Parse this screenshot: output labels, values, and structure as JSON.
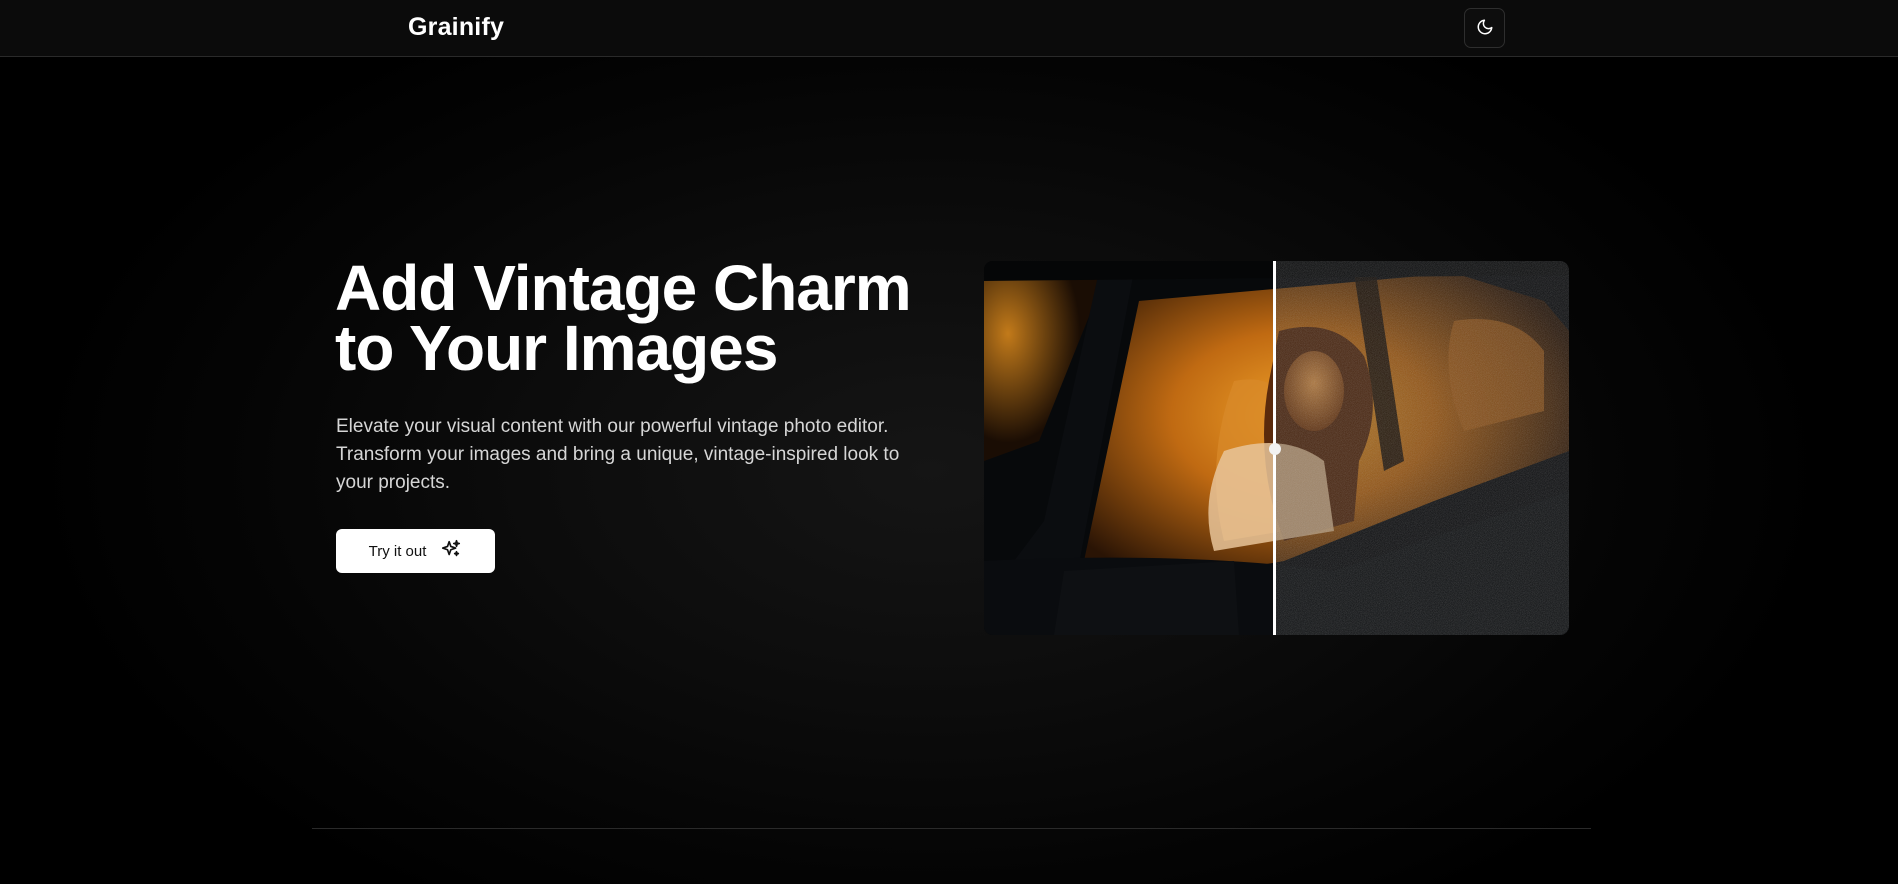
{
  "navbar": {
    "brand": "Grainify",
    "theme_toggle_icon": "moon-icon"
  },
  "hero": {
    "title_line_1": "Add Vintage Charm",
    "title_line_2": "to Your Images",
    "description": "Elevate your visual content with our powerful vintage photo editor. Transform your images and bring a unique, vintage-inspired look to your projects.",
    "cta_label": "Try it out",
    "cta_icon": "sparkles-icon"
  },
  "compare": {
    "left_icon": "original-photo",
    "right_icon": "grain-photo",
    "split_fraction": 0.5,
    "handle_icon": "drag-handle"
  },
  "colors": {
    "background": "#000000",
    "navbar": "#0b0b0b",
    "accent_warm": "#e08a1c",
    "button_bg": "#ffffff"
  }
}
